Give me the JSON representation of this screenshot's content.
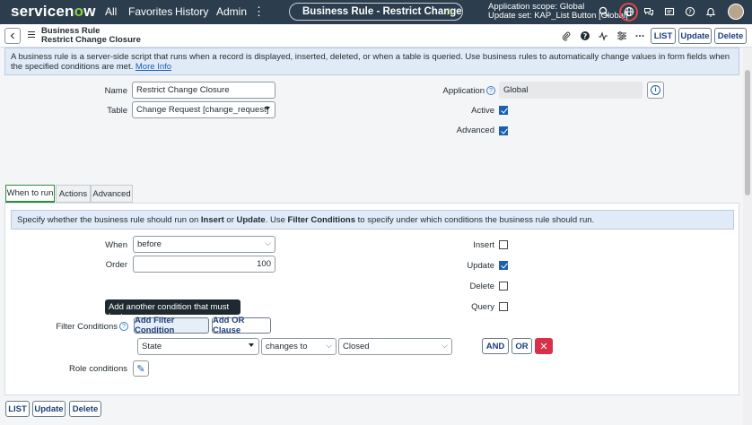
{
  "header": {
    "logo": "servicenow",
    "nav": [
      "All",
      "Favorites",
      "History",
      "Admin"
    ],
    "page_title": "Business Rule - Restrict Change Clos...",
    "scope_line1": "Application scope: Global",
    "scope_line2": "Update set: KAP_List Button [Global]",
    "icons": [
      "search-icon",
      "globe-icon",
      "chat-icon",
      "inbox-icon",
      "help-icon",
      "bell-icon",
      "user-avatar"
    ]
  },
  "form_header": {
    "record_type": "Business Rule",
    "record_name": "Restrict Change Closure",
    "buttons": {
      "list": "LIST",
      "update": "Update",
      "delete": "Delete"
    }
  },
  "banner": {
    "text": "A business rule is a server-side script that runs when a record is displayed, inserted, deleted, or when a table is queried. Use business rules to automatically change values in form fields when the specified conditions are met.",
    "link": "More Info"
  },
  "fields": {
    "name_label": "Name",
    "name_value": "Restrict Change Closure",
    "table_label": "Table",
    "table_value": "Change Request [change_request]",
    "application_label": "Application",
    "application_value": "Global",
    "active_label": "Active",
    "active_checked": true,
    "advanced_label": "Advanced",
    "advanced_checked": true
  },
  "tabs": [
    "When to run",
    "Actions",
    "Advanced"
  ],
  "when_to_run": {
    "banner_text_1": "Specify whether the business rule should run on ",
    "banner_bold_1": "Insert",
    "banner_text_2": " or ",
    "banner_bold_2": "Update",
    "banner_text_3": ". Use ",
    "banner_bold_3": "Filter Conditions",
    "banner_text_4": " to specify under which conditions the business rule should run.",
    "when_label": "When",
    "when_value": "before",
    "order_label": "Order",
    "order_value": "100",
    "insert_label": "Insert",
    "insert_checked": false,
    "update_label": "Update",
    "update_checked": true,
    "delete_label": "Delete",
    "delete_checked": false,
    "query_label": "Query",
    "query_checked": false,
    "tooltip": "Add another condition that must be true",
    "filter_label": "Filter Conditions",
    "add_filter_condition": "Add Filter Condition",
    "add_or_clause": "Add OR Clause",
    "condition": {
      "field": "State",
      "operator": "changes to",
      "value": "Closed"
    },
    "and_label": "AND",
    "or_label": "OR",
    "role_label": "Role conditions"
  },
  "footer_buttons": {
    "list": "LIST",
    "update": "Update",
    "delete": "Delete"
  },
  "colors": {
    "header_bg": "#2c3e4e",
    "accent_blue": "#1b5fb4",
    "danger": "#d9304a",
    "tab_active": "#2e8b3e"
  }
}
